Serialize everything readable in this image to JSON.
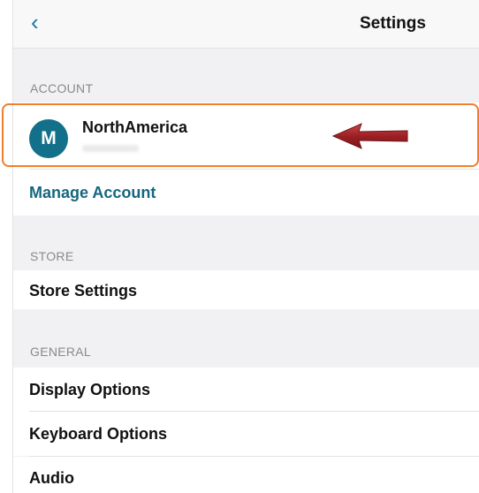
{
  "navbar": {
    "back_symbol": "‹",
    "title": "Settings"
  },
  "account": {
    "header": "ACCOUNT",
    "avatar_initial": "M",
    "name": "NorthAmerica",
    "manage_label": "Manage Account"
  },
  "store": {
    "header": "STORE",
    "items": [
      "Store Settings"
    ]
  },
  "general": {
    "header": "GENERAL",
    "items": [
      "Display Options",
      "Keyboard Options",
      "Audio"
    ]
  },
  "colors": {
    "accent": "#14677f",
    "avatar": "#13708a",
    "highlight": "#ef7f2c",
    "arrow": "#a0282a"
  },
  "icons": {
    "back": "chevron-left-icon",
    "annotation_arrow": "arrow-left-icon"
  }
}
